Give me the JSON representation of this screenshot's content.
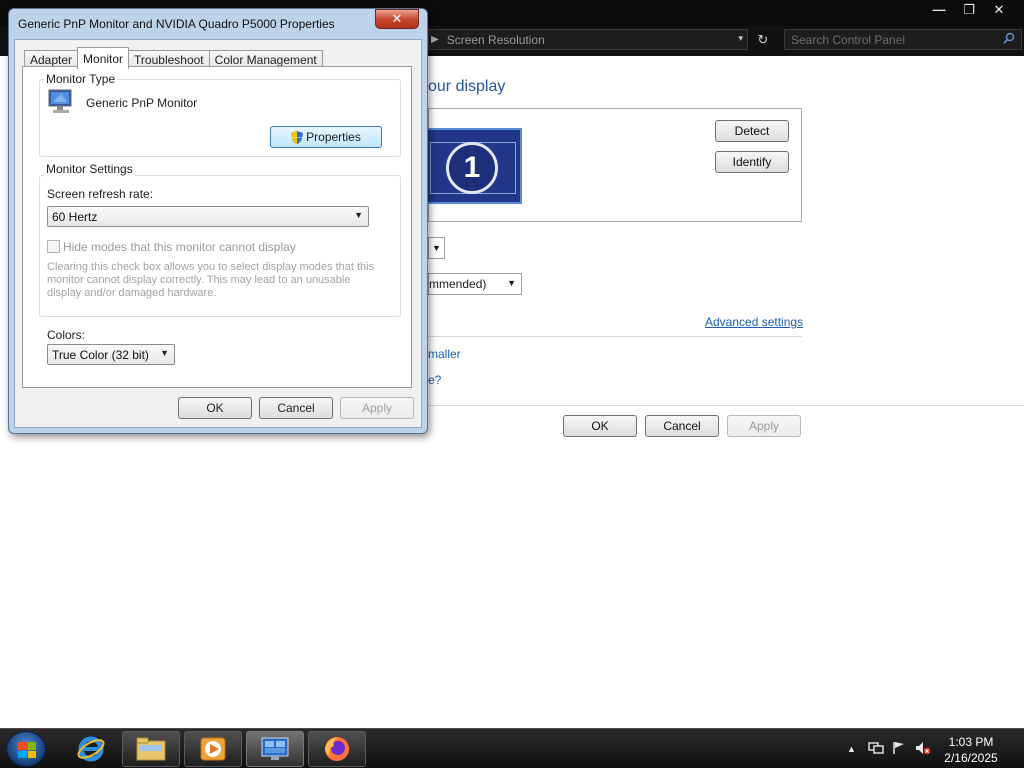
{
  "control_panel": {
    "window_controls": {
      "minimize": "—",
      "maximize": "❐",
      "close": "✕"
    },
    "address": {
      "breadcrumb": "Screen Resolution",
      "separator": "▶",
      "dropdown": "▾",
      "refresh": "↻"
    },
    "search": {
      "placeholder": "Search Control Panel"
    },
    "heading": "our display",
    "monitor_number": "1",
    "detect_label": "Detect",
    "identify_label": "Identify",
    "resolution_fragment": "mmended)",
    "advanced_settings_link": "Advanced settings",
    "smaller_link_fragment": "maller",
    "question_fragment": "e?",
    "ok_label": "OK",
    "cancel_label": "Cancel",
    "apply_label": "Apply"
  },
  "dialog": {
    "title": "Generic PnP Monitor and NVIDIA Quadro P5000 Properties",
    "close_glyph": "✕",
    "tabs": [
      {
        "label": "Adapter",
        "active": false
      },
      {
        "label": "Monitor",
        "active": true
      },
      {
        "label": "Troubleshoot",
        "active": false
      },
      {
        "label": "Color Management",
        "active": false
      }
    ],
    "monitor_type": {
      "group_label": "Monitor Type",
      "monitor_name": "Generic PnP Monitor",
      "properties_label": "Properties"
    },
    "monitor_settings": {
      "group_label": "Monitor Settings",
      "refresh_label": "Screen refresh rate:",
      "refresh_value": "60 Hertz",
      "hide_modes_label": "Hide modes that this monitor cannot display",
      "hide_modes_checked": false,
      "description": "Clearing this check box allows you to select display modes that this monitor cannot display correctly. This may lead to an unusable display and/or damaged hardware."
    },
    "colors": {
      "label": "Colors:",
      "value": "True Color (32 bit)"
    },
    "buttons": {
      "ok": "OK",
      "cancel": "Cancel",
      "apply": "Apply"
    }
  },
  "taskbar": {
    "tray": {
      "show_hidden": "▲"
    },
    "time": "1:03 PM",
    "date": "2/16/2025"
  },
  "colors": {
    "dialog_frame": "#bcd3ea",
    "link": "#1a5fb4",
    "heading": "#22569b",
    "taskbar": "#111111"
  }
}
